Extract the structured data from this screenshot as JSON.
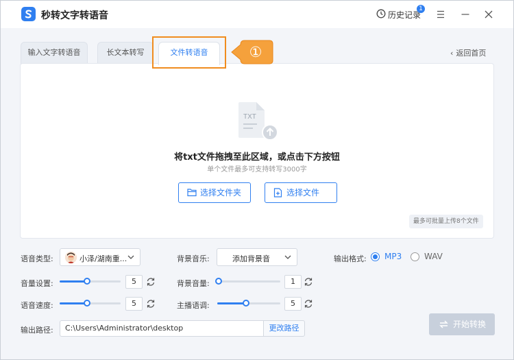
{
  "app": {
    "title": "秒转文字转语音"
  },
  "header": {
    "history_label": "历史记录",
    "history_badge": "1"
  },
  "tabs": [
    {
      "label": "输入文字转语音"
    },
    {
      "label": "长文本转写"
    },
    {
      "label": "文件转语音",
      "active": true
    }
  ],
  "annotation": {
    "marker": "①",
    "color": "#f08c1e"
  },
  "nav": {
    "back_home": "返回首页"
  },
  "drop": {
    "icon_text": "TXT",
    "title": "将txt文件拖拽至此区域，或点击下方按钮",
    "subtitle": "单个文件最多可支持转写3000字",
    "select_folder": "选择文件夹",
    "select_file": "选择文件",
    "batch_tip": "最多可批量上传8个文件"
  },
  "settings": {
    "voice_type_label": "语音类型:",
    "voice_value": "小泽/湖南重...",
    "bgm_label": "背景音乐:",
    "bgm_value": "添加背景音",
    "format_label": "输出格式:",
    "formats": [
      {
        "label": "MP3",
        "selected": true
      },
      {
        "label": "WAV",
        "selected": false
      }
    ],
    "volume_label": "音量设置:",
    "volume_value": "5",
    "bgm_volume_label": "背景音量:",
    "bgm_volume_value": "1",
    "speed_label": "语音速度:",
    "speed_value": "5",
    "pitch_label": "主播语调:",
    "pitch_value": "5",
    "output_label": "输出路径:",
    "output_path": "C:\\Users\\Administrator\\desktop",
    "change_path": "更改路径",
    "start_label": "开始转换"
  },
  "colors": {
    "accent": "#2f7ff0",
    "disabled_button": "#c8d0dc"
  }
}
